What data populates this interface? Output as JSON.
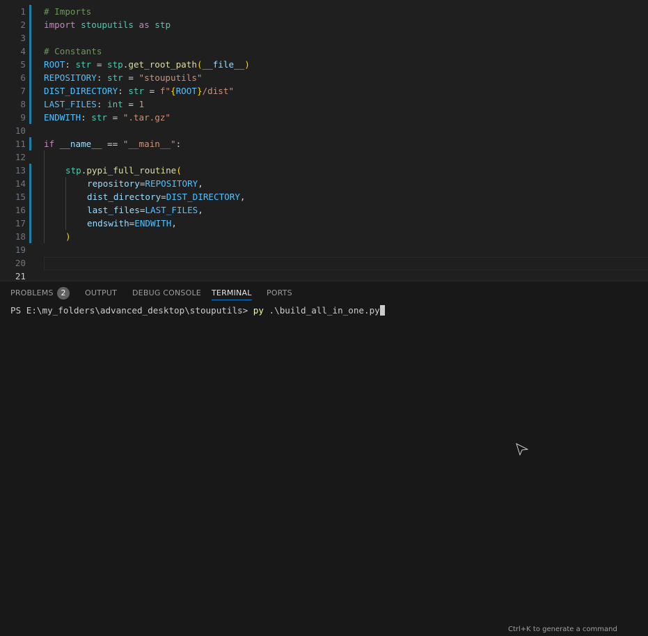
{
  "editor": {
    "line_numbers": [
      "1",
      "2",
      "3",
      "4",
      "5",
      "6",
      "7",
      "8",
      "9",
      "10",
      "11",
      "12",
      "13",
      "14",
      "15",
      "16",
      "17",
      "18",
      "19",
      "20",
      "21"
    ],
    "lines": {
      "l2": "# Imports",
      "l3_import": "import",
      "l3_module": "stouputils",
      "l3_as": "as",
      "l3_alias": "stp",
      "l5": "# Constants",
      "l6_name": "ROOT",
      "l6_type": "str",
      "l6_mod": "stp",
      "l6_fn": "get_root_path",
      "l6_arg": "__file__",
      "l7_name": "REPOSITORY",
      "l7_type": "str",
      "l7_value": "\"stouputils\"",
      "l8_name": "DIST_DIRECTORY",
      "l8_type": "str",
      "l8_prefix": "f\"",
      "l8_expr": "ROOT",
      "l8_rest": "/dist\"",
      "l9_name": "LAST_FILES",
      "l9_type": "int",
      "l9_value": "1",
      "l10_name": "ENDWITH",
      "l10_type": "str",
      "l10_value": "\".tar.gz\"",
      "l12_if": "if",
      "l12_name": "__name__",
      "l12_value": "\"__main__\"",
      "l14_mod": "stp",
      "l14_fn": "pypi_full_routine",
      "l15_kw": "repository",
      "l15_val": "REPOSITORY",
      "l16_kw": "dist_directory",
      "l16_val": "DIST_DIRECTORY",
      "l17_kw": "last_files",
      "l17_val": "LAST_FILES",
      "l18_kw": "endswith",
      "l18_val": "ENDWITH",
      "l19": ")"
    }
  },
  "panel": {
    "tabs": {
      "problems": "PROBLEMS",
      "problems_count": "2",
      "output": "OUTPUT",
      "debug_console": "DEBUG CONSOLE",
      "terminal": "TERMINAL",
      "ports": "PORTS"
    },
    "terminal": {
      "prompt": "PS E:\\my_folders\\advanced_desktop\\stouputils> ",
      "command": "py",
      "argument": " .\\build_all_in_one.py"
    },
    "hint": "Ctrl+K to generate a command"
  },
  "colors": {
    "background": "#1f1f1f",
    "panel_background": "#181818",
    "accent": "#0078d4",
    "gutter_modified": "#1b81a8"
  },
  "icons": {
    "mouse_cursor": "arrow-pointer-icon"
  }
}
